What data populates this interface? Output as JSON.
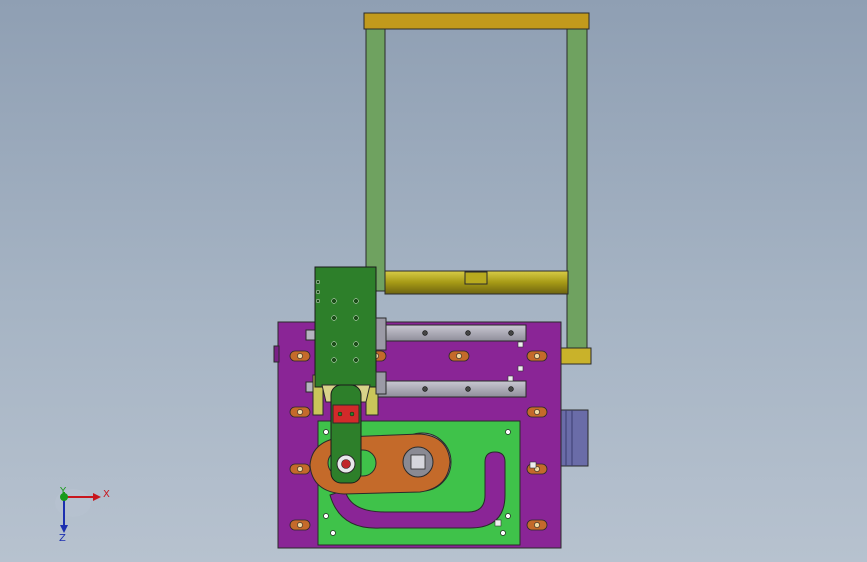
{
  "triad": {
    "x_label": "X",
    "y_label": "Y",
    "z_label": "Z",
    "x_color": "#c8161d",
    "y_color": "#1a9a1a",
    "z_color": "#1c2fb0"
  },
  "colors": {
    "frame_top": "#c29a1c",
    "frame_post": "#6fa260",
    "shaft": "#b1a51a",
    "base_plate": "#8a2596",
    "green_plate": "#3fc24a",
    "arm": "#2d7f2a",
    "lever": "#c46a2a",
    "rail": "#9b9aa6",
    "block": "#c9c65a",
    "side_motor": "#6a6ca8"
  }
}
